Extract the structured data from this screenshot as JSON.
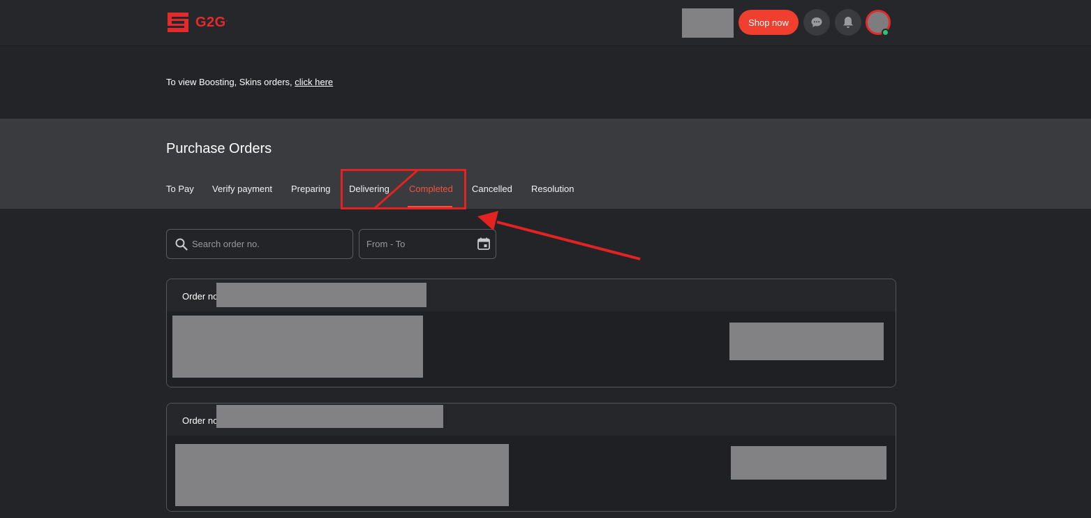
{
  "header": {
    "logo_text": "G2G",
    "logo_mark": "TM",
    "shop_label": "Shop now",
    "chat_icon": "chat-bubble-icon",
    "bell_icon": "bell-icon",
    "brand_color": "#e32b2b",
    "accent_color": "#f03e2f"
  },
  "notice": {
    "text": "To view Boosting, Skins orders, ",
    "link": "click here"
  },
  "orders": {
    "title": "Purchase Orders",
    "tabs": [
      {
        "label": "To Pay",
        "active": false
      },
      {
        "label": "Verify payment",
        "active": false
      },
      {
        "label": "Preparing",
        "active": false
      },
      {
        "label": "Delivering",
        "active": false
      },
      {
        "label": "Completed",
        "active": true
      },
      {
        "label": "Cancelled",
        "active": false
      },
      {
        "label": "Resolution",
        "active": false
      }
    ]
  },
  "filters": {
    "search_placeholder": "Search order no.",
    "date_placeholder": "From - To"
  },
  "order_cards": [
    {
      "label": "Order no."
    },
    {
      "label": "Order no."
    }
  ],
  "annotation": {
    "color": "#e32222"
  }
}
